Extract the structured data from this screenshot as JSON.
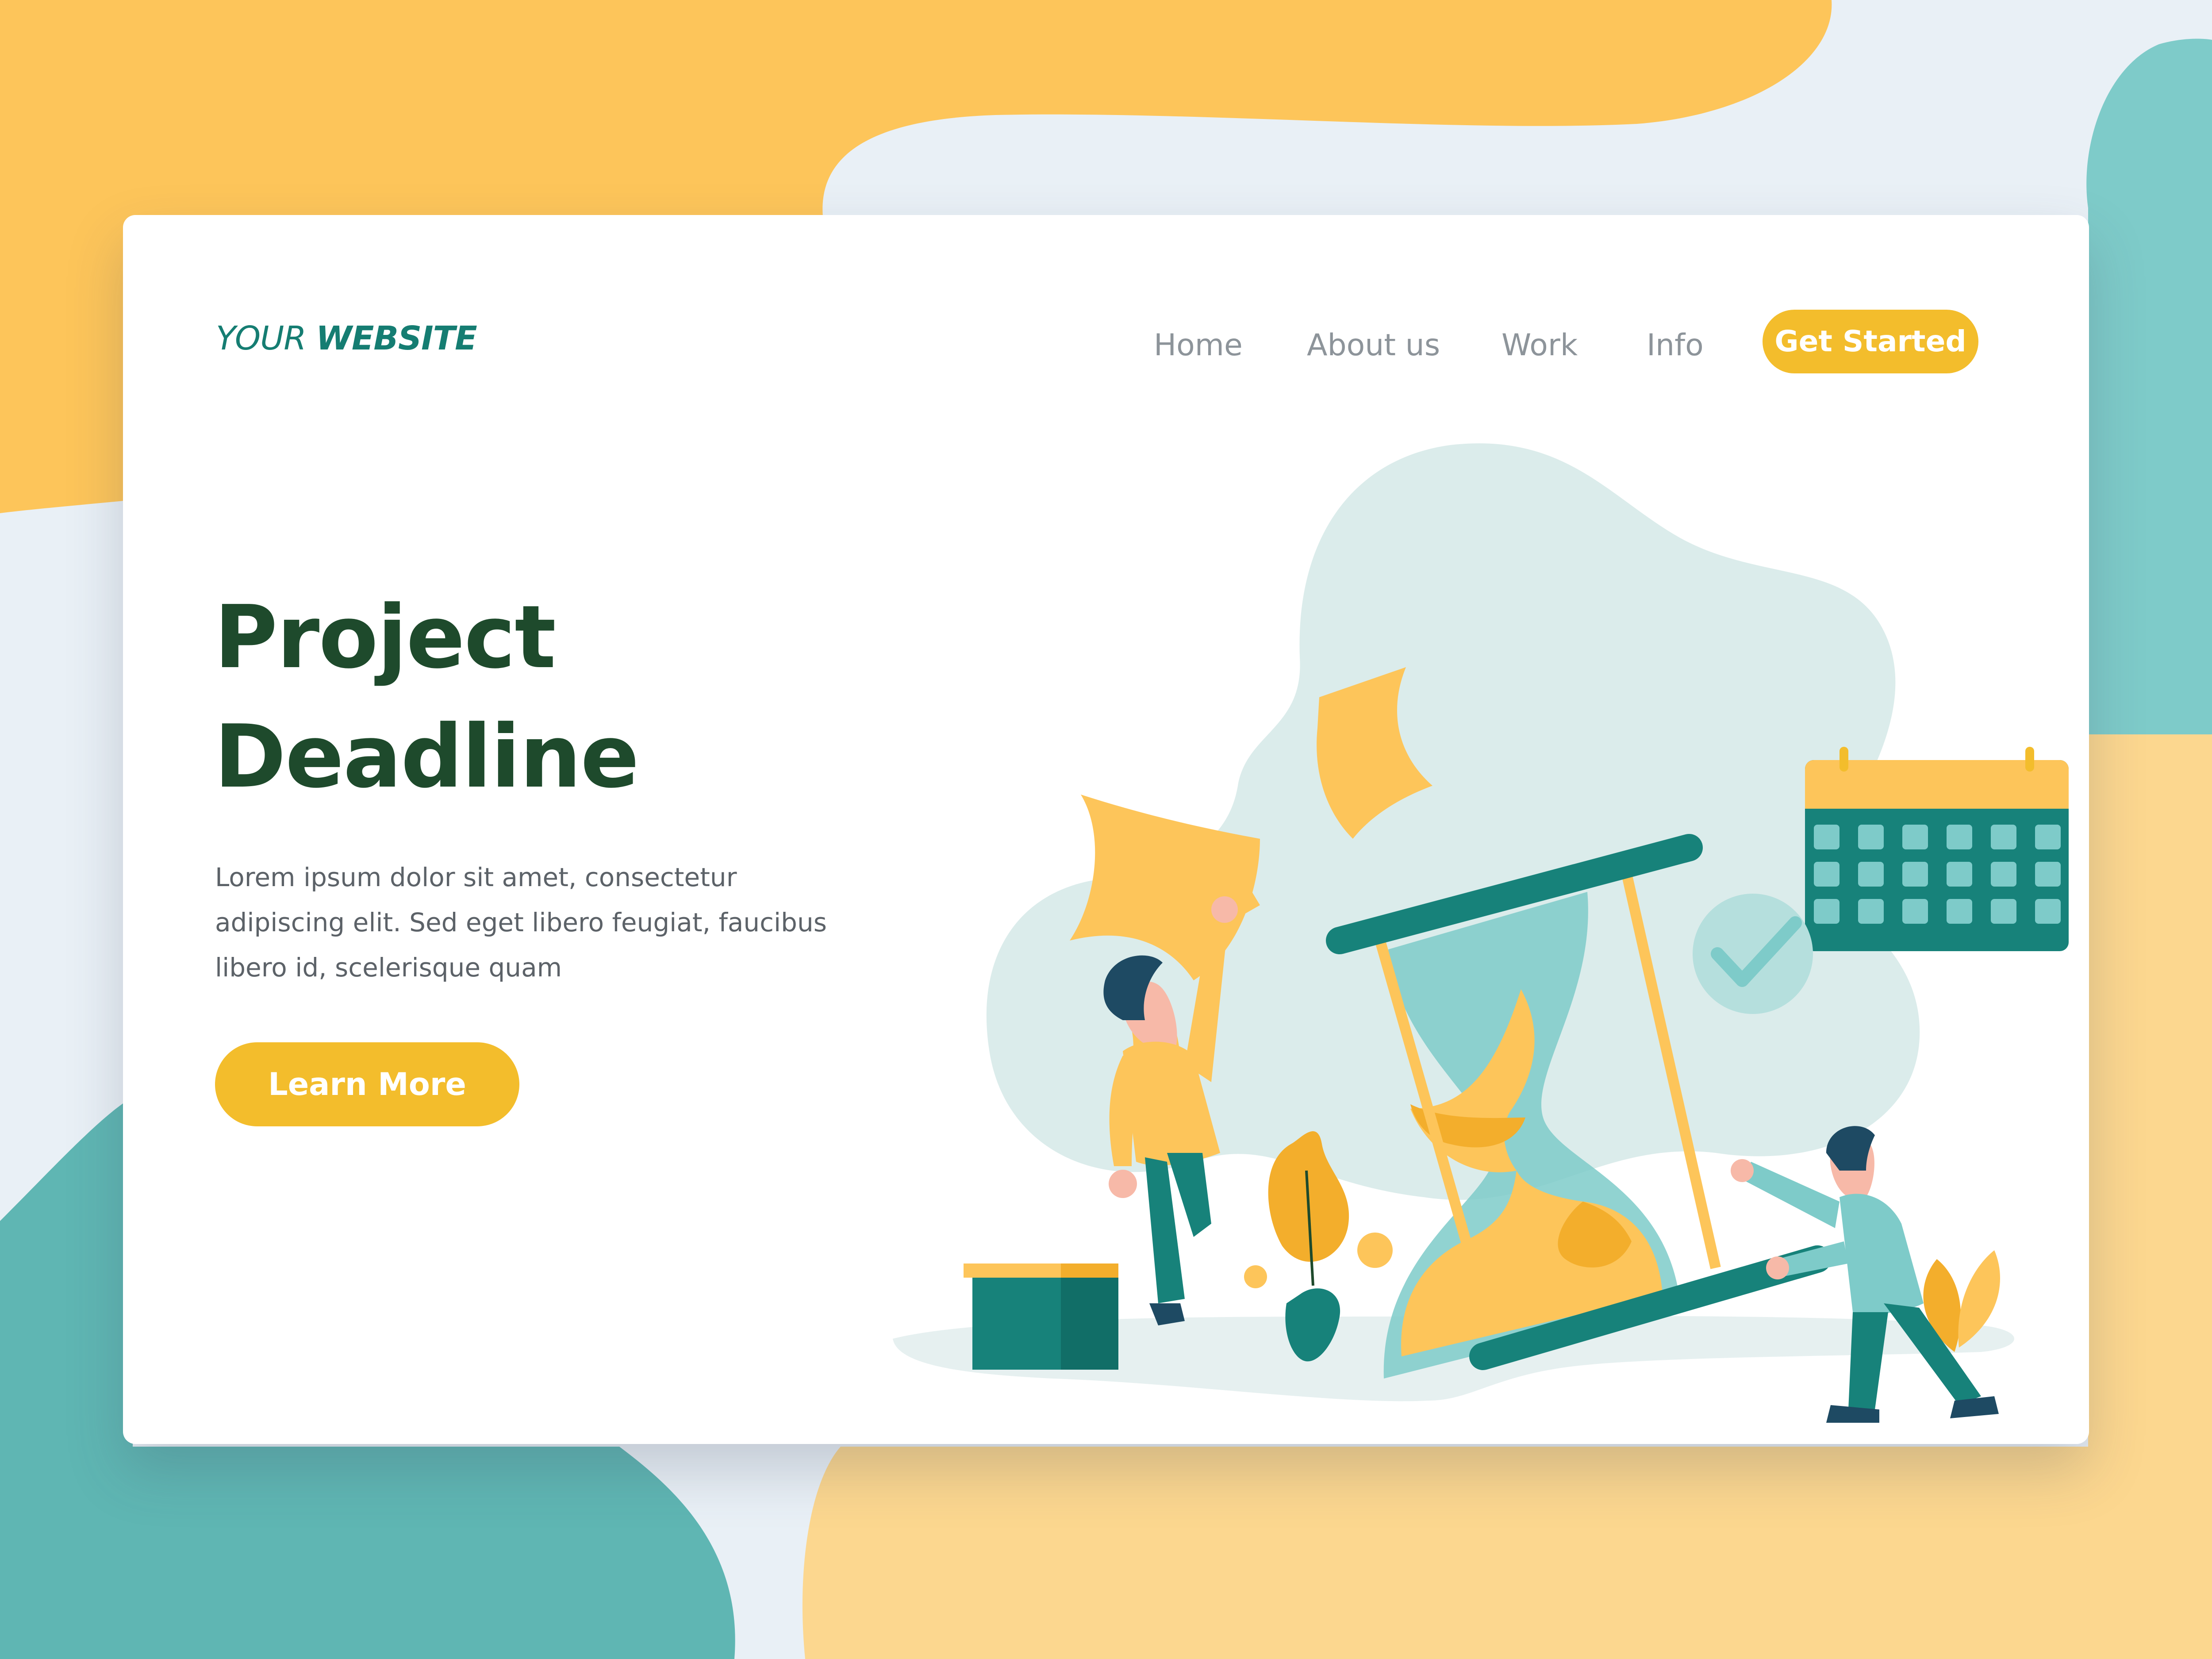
{
  "logo": {
    "light": "YOUR ",
    "bold": "WEBSITE"
  },
  "nav": {
    "items": [
      {
        "label": "Home"
      },
      {
        "label": "About us"
      },
      {
        "label": "Work"
      },
      {
        "label": "Info"
      }
    ],
    "cta_label": "Get Started"
  },
  "hero": {
    "title_lines": [
      "Project",
      "Deadline"
    ],
    "body_lines": [
      "Lorem ipsum dolor sit amet, consectetur",
      "adipiscing elit. Sed eget libero feugiat, faucibus",
      "libero id, scelerisque quam"
    ],
    "button_label": "Learn More"
  },
  "colors": {
    "accent_yellow": "#f3bd2c",
    "teal": "#157d72",
    "heading_green": "#1e4a2c",
    "light_teal": "#7ecbc9",
    "background_yellow": "#fdc55a"
  },
  "icons": [
    "hourglass-icon",
    "calendar-icon",
    "checkmark-icon"
  ]
}
